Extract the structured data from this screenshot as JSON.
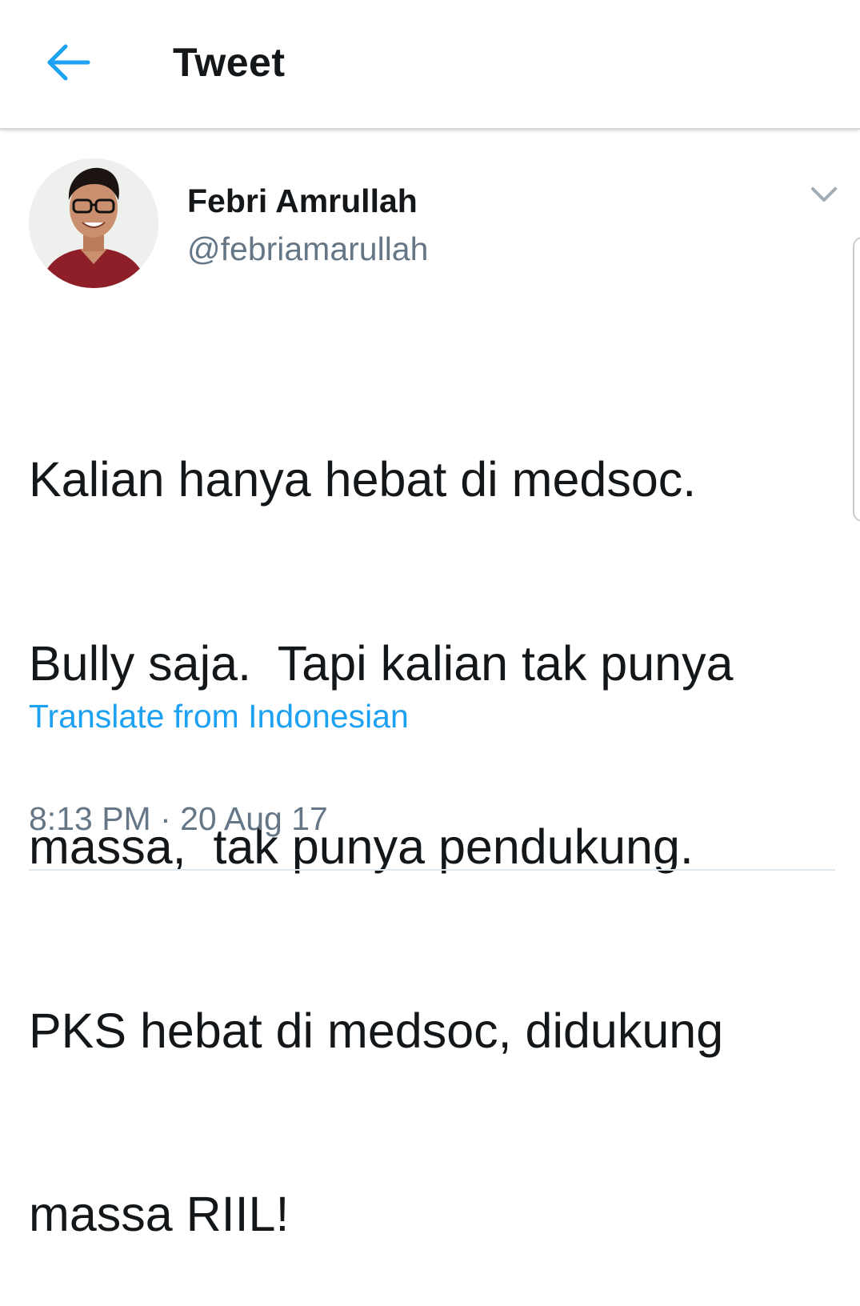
{
  "header": {
    "title": "Tweet",
    "back_icon": "arrow-left-icon",
    "accent_color": "#1da1f2"
  },
  "tweet": {
    "author": {
      "display_name": "Febri Amrullah",
      "username": "@febriamarullah",
      "avatar": "avatar-photo"
    },
    "menu_icon": "chevron-down-icon",
    "lines": [
      "Kalian hanya hebat di medsoc.",
      "Bully saja.  Tapi kalian tak punya",
      "massa,  tak punya pendukung.",
      "PKS hebat di medsoc, didukung",
      "massa RIIL!"
    ],
    "translate_label": "Translate from Indonesian",
    "timestamp": "8:13 PM · 20 Aug 17"
  },
  "colors": {
    "text_primary": "#14171a",
    "text_secondary": "#657786",
    "link": "#1da1f2",
    "divider": "#e1e8ed"
  }
}
